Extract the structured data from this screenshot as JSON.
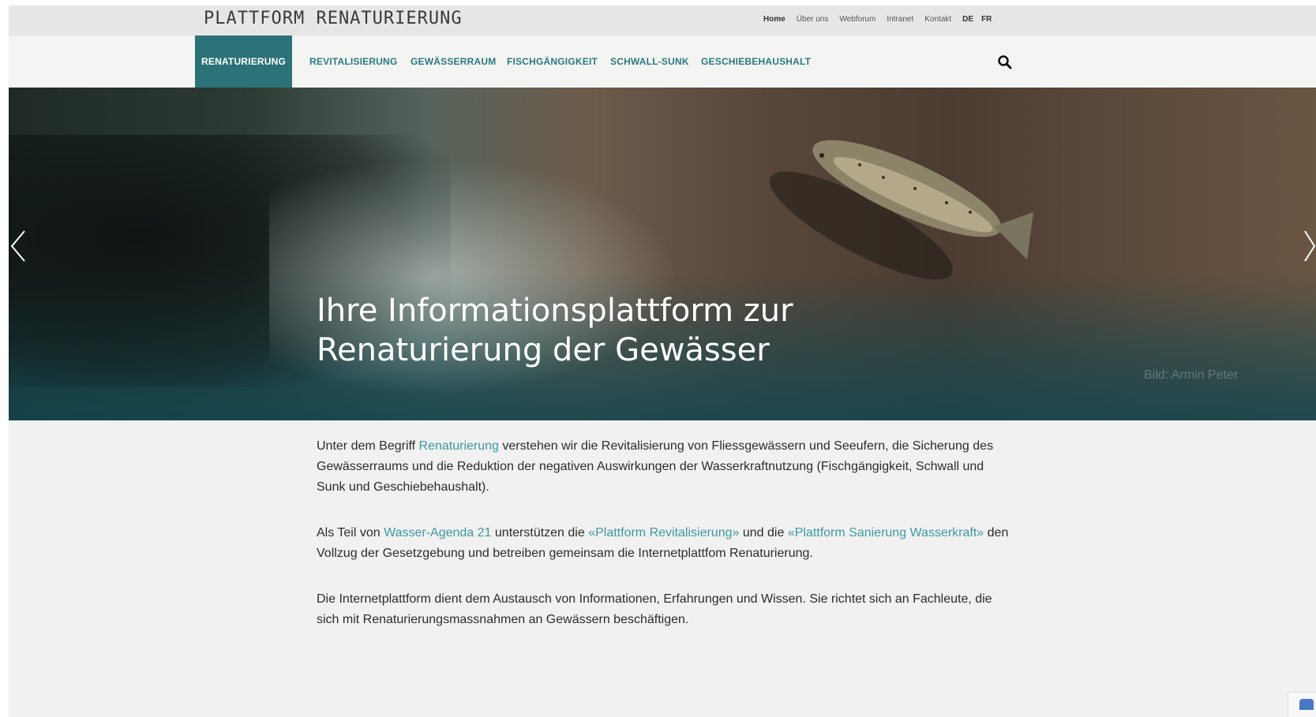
{
  "header": {
    "logo": "PLATTFORM RENATURIERUNG",
    "utility_nav": [
      "Home",
      "Über uns",
      "Webforum",
      "Intranet",
      "Kontakt"
    ],
    "languages": [
      "DE",
      "FR"
    ]
  },
  "main_nav": {
    "items": [
      "RENATURIERUNG",
      "REVITALISIERUNG",
      "GEWÄSSERRAUM",
      "FISCHGÄNGIGKEIT",
      "SCHWALL-SUNK",
      "GESCHIEBEHAUSHALT"
    ],
    "active_index": 0
  },
  "hero": {
    "title_line1": "Ihre Informationsplattform zur",
    "title_line2": "Renaturierung der Gewässer",
    "photo_credit": "Bild: Armin Peter"
  },
  "content": {
    "p1_before": "Unter dem Begriff ",
    "p1_link": "Renaturierung",
    "p1_after": " verstehen wir die Revitalisierung von Fliessgewässern und Seeufern, die Sicherung des Gewässerraums und die Reduktion der negativen Auswirkungen der Wasserkraftnutzung (Fischgängigkeit, Schwall und Sunk und Geschiebehaushalt).",
    "p2_a": "Als Teil von ",
    "p2_link1": "Wasser-Agenda 21",
    "p2_b": " unterstützen die ",
    "p2_link2": "«Plattform Revitalisierung»",
    "p2_c": " und die ",
    "p2_link3": "«Plattform Sanierung Wasserkraft»",
    "p2_d": " den Vollzug der Gesetzgebung und betreiben gemeinsam die Internetplattfom Renaturierung.",
    "p3": "Die Internetplattform dient dem Austausch von Informationen, Erfahrungen und Wissen. Sie richtet sich an Fachleute, die sich mit Renaturierungsmassnahmen an Gewässern beschäftigen."
  },
  "icons": {
    "search": "search-icon",
    "prev": "chevron-left-icon",
    "next": "chevron-right-icon"
  },
  "colors": {
    "accent": "#2b7378",
    "link": "#3d9aa0"
  }
}
